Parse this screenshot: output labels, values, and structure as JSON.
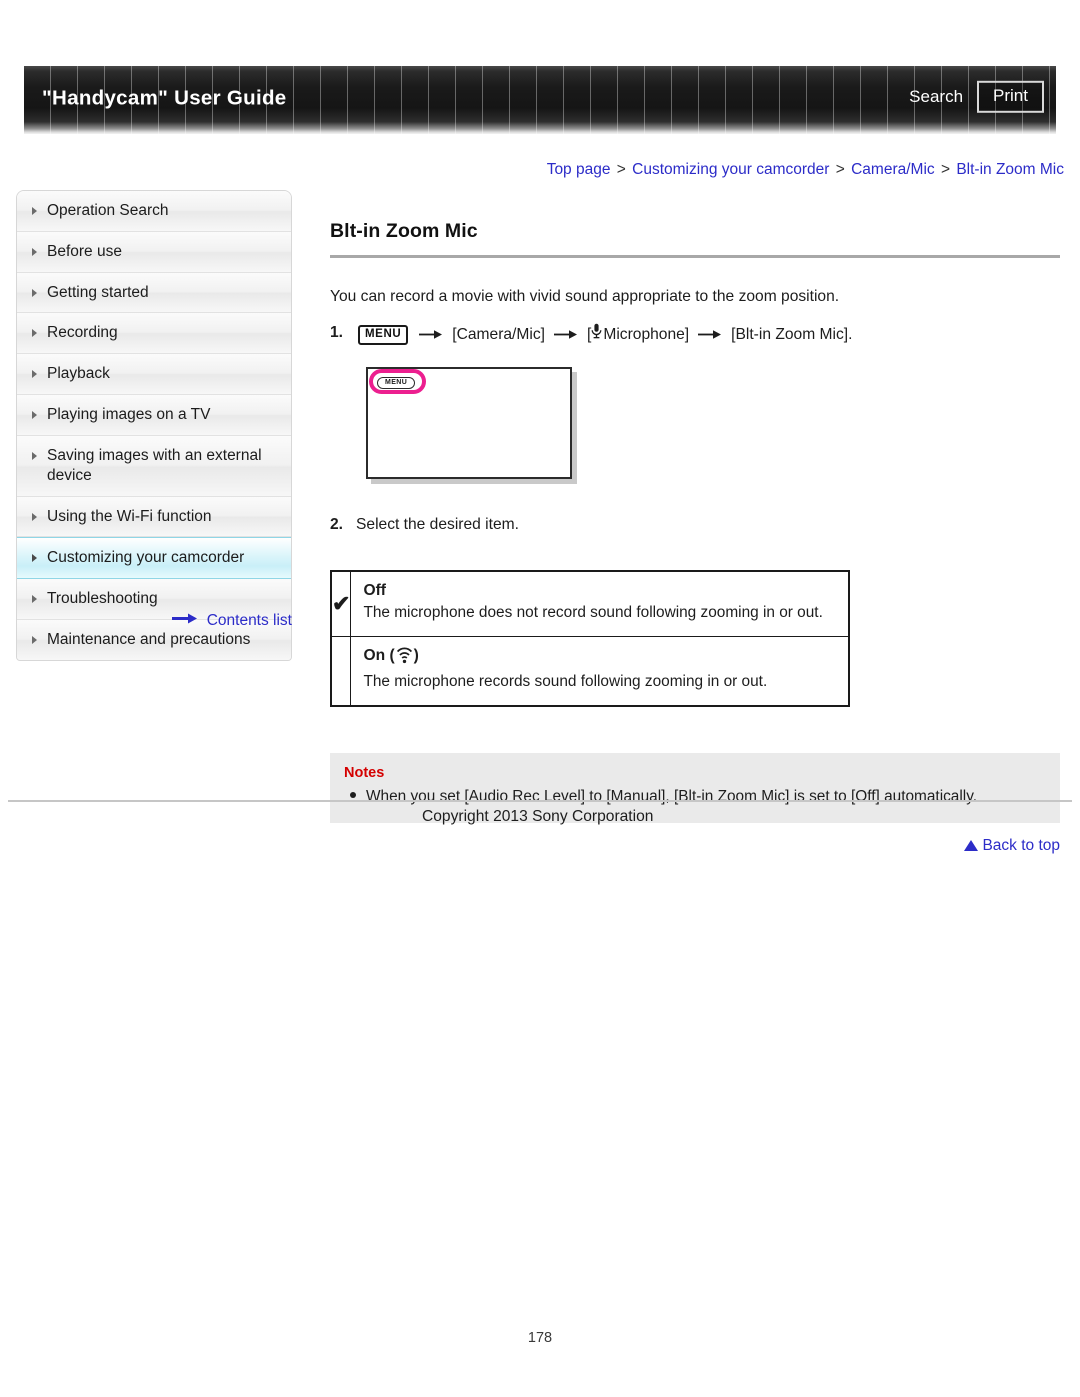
{
  "header": {
    "title": "\"Handycam\" User Guide",
    "search_label": "Search",
    "print_label": "Print"
  },
  "breadcrumb": {
    "items": [
      "Top page",
      "Customizing your camcorder",
      "Camera/Mic",
      "Blt-in Zoom Mic"
    ],
    "separator": ">"
  },
  "sidebar": {
    "items": [
      {
        "label": "Operation Search",
        "active": false
      },
      {
        "label": "Before use",
        "active": false
      },
      {
        "label": "Getting started",
        "active": false
      },
      {
        "label": "Recording",
        "active": false
      },
      {
        "label": "Playback",
        "active": false
      },
      {
        "label": "Playing images on a TV",
        "active": false
      },
      {
        "label": "Saving images with an external device",
        "active": false
      },
      {
        "label": "Using the Wi-Fi function",
        "active": false
      },
      {
        "label": "Customizing your camcorder",
        "active": true
      },
      {
        "label": "Troubleshooting",
        "active": false
      },
      {
        "label": "Maintenance and precautions",
        "active": false
      }
    ],
    "contents_link": "Contents list",
    "contents_icon": "right-arrow-icon"
  },
  "main": {
    "title": "Blt-in Zoom Mic",
    "intro": "You can record a movie with vivid sound appropriate to the zoom position.",
    "step1": {
      "number": "1.",
      "menu_chip": "MENU",
      "part_camera_mic": "[Camera/Mic]",
      "part_microphone": "Microphone]",
      "part_microphone_prefix": "[",
      "part_target": "[Blt-in Zoom Mic].",
      "mic_icon": "microphone-icon",
      "arrow": "→"
    },
    "illustration": {
      "menu_label": "MENU",
      "highlight_color": "#ec1f8f"
    },
    "step2": {
      "number": "2.",
      "text": "Select the desired item."
    },
    "options_table": {
      "rows": [
        {
          "checked": true,
          "check_mark": "✔",
          "name": "Off",
          "icon": "",
          "description": "The microphone does not record sound following zooming in or out."
        },
        {
          "checked": false,
          "check_mark": "",
          "name": "On",
          "icon": "zoom-mic-icon",
          "icon_open": "(",
          "icon_close": ")",
          "description": "The microphone records sound following zooming in or out."
        }
      ]
    },
    "notes": {
      "heading": "Notes",
      "items": [
        "When you set [Audio Rec Level] to [Manual], [Blt-in Zoom Mic] is set to [Off] automatically."
      ]
    },
    "back_to_top": "Back to top"
  },
  "footer": {
    "copyright": "Copyright 2013 Sony Corporation",
    "page_number": "178"
  },
  "colors": {
    "link": "#2c2cc8",
    "notes_heading": "#d40000",
    "highlight_pink": "#ec1f8f",
    "sidebar_active": "#c9eff8"
  }
}
